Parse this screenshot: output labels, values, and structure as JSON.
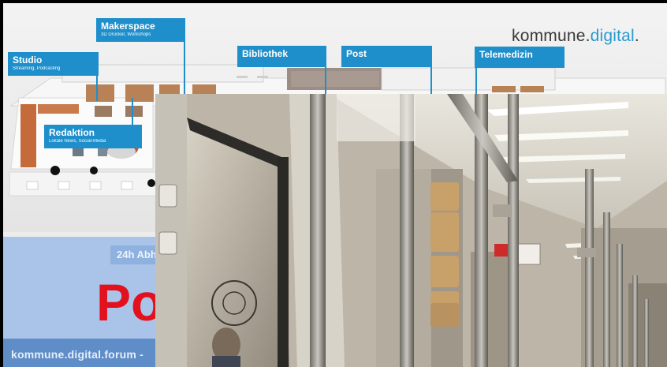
{
  "brand": {
    "name": "kommune.",
    "accent": "digital",
    "suffix": "."
  },
  "rooms": [
    {
      "title": "Makerspace",
      "subtitle": "3D Drucker, Workshops"
    },
    {
      "title": "Studio",
      "subtitle": "Streaming, Podcasting"
    },
    {
      "title": "Bibliothek",
      "subtitle": ""
    },
    {
      "title": "Post",
      "subtitle": ""
    },
    {
      "title": "Telemedizin",
      "subtitle": ""
    },
    {
      "title": "Redaktion",
      "subtitle": "Lokale News, Social-Media"
    }
  ],
  "banner": {
    "hours": "24h Abh",
    "headline": "Po",
    "footer": "kommune.digital.forum -"
  },
  "colors": {
    "accent": "#1f8fcb",
    "headline": "#e3101d",
    "banner": "#a9c4e8",
    "footer_bar": "#5e8dc7"
  },
  "photo": {
    "subject": "train interior",
    "icons": [
      "wheelchair-icon",
      "bicycle-icon",
      "door-info-icon"
    ]
  }
}
